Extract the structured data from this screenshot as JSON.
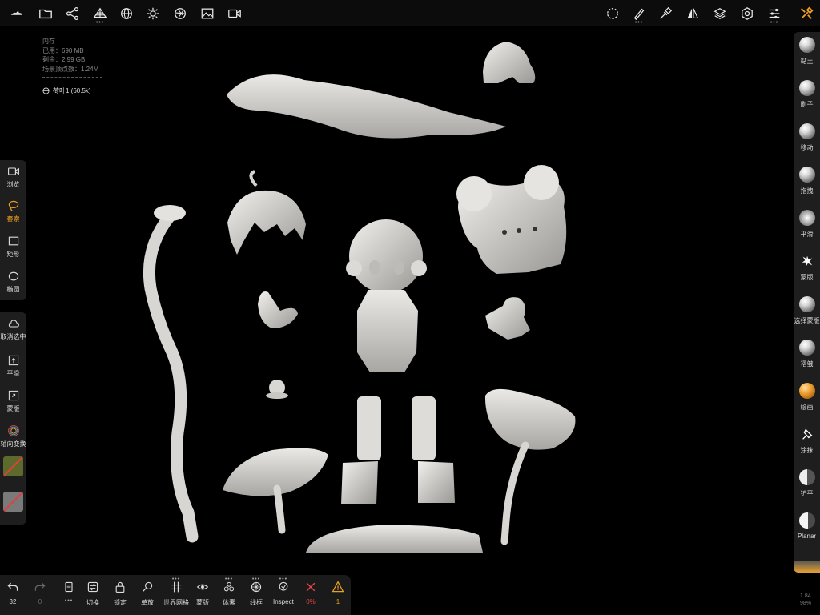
{
  "app": {
    "accent_color": "#f0a020",
    "background_color": "#000000"
  },
  "topbar": {
    "left_icons": [
      "logo-icon",
      "folder-icon",
      "scene-graph-icon",
      "topology-icon",
      "globe-icon",
      "sun-icon",
      "aperture-icon",
      "image-icon",
      "video-camera-icon"
    ],
    "right_icons": [
      "lasso-select-icon",
      "brush-stroke-icon",
      "picker-icon",
      "symmetry-icon",
      "layers-icon",
      "settings-icon",
      "sliders-icon",
      "tools-icon"
    ]
  },
  "memory": {
    "title": "内存",
    "used": "已用：690 MB",
    "free": "剩余：2.99 GB",
    "vertices": "场景顶点数：1.24M"
  },
  "mesh": {
    "name": "荷叶1 (60.5k)"
  },
  "left_tools": {
    "browse": "浏览",
    "lasso": "套索",
    "rect": "矩形",
    "ellipse": "椭圆",
    "cancel_selection": "取消选中",
    "smooth": "平滑",
    "mask": "蒙版",
    "axis_transform": "轴向变换"
  },
  "right_brushes": [
    "黏土",
    "刷子",
    "移动",
    "拖拽",
    "平滑",
    "蒙版",
    "选择蒙版",
    "褶皱",
    "绘画",
    "涂抹",
    "铲平",
    "Planar"
  ],
  "bottom": {
    "undo_count": "32",
    "redo_count": "0",
    "switch": "切换",
    "lock": "锁定",
    "single": "单放",
    "world_grid": "世界网格",
    "mask": "蒙版",
    "voxel": "体素",
    "wireframe": "线框",
    "inspect": "Inspect",
    "percent": "0%",
    "warning": "1"
  },
  "stats": {
    "line1": "1.84",
    "line2": "98%"
  }
}
